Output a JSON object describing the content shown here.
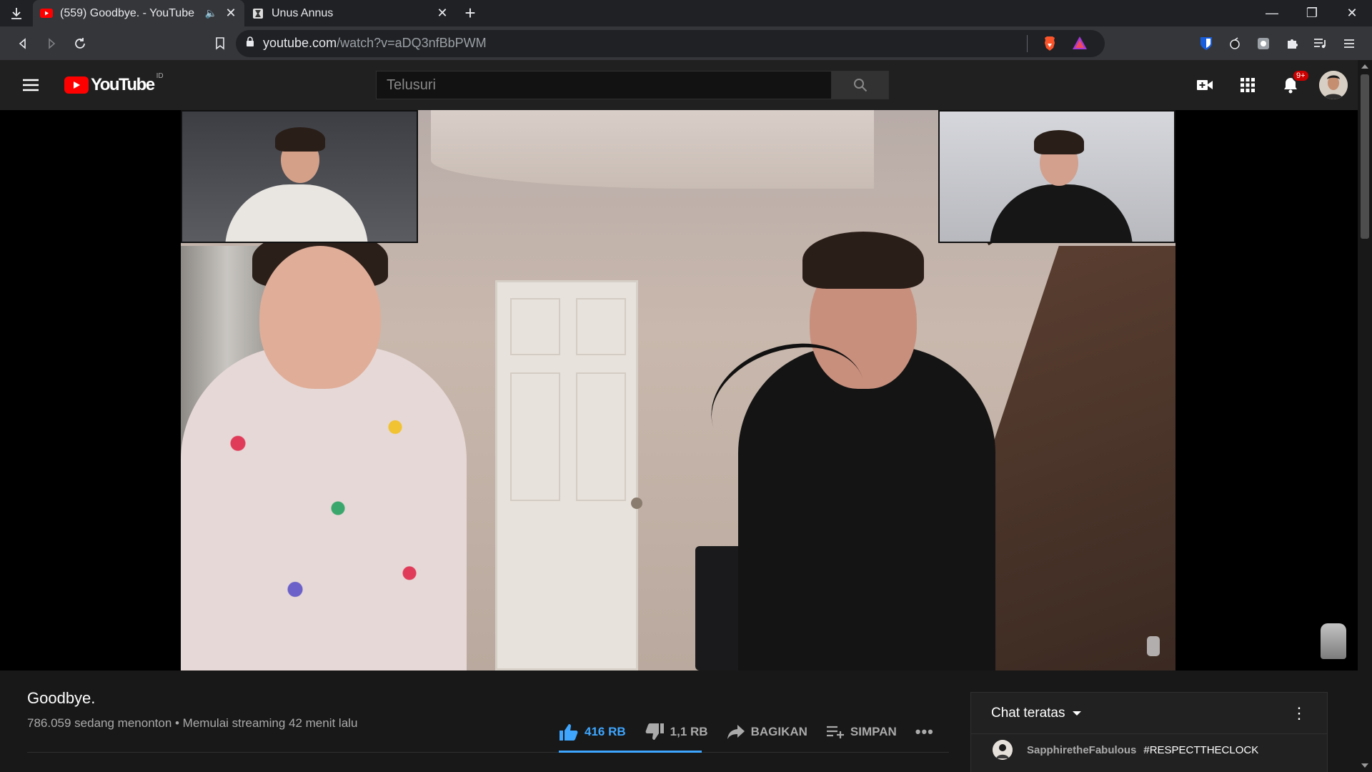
{
  "browser": {
    "tabs": [
      {
        "title": "(559) Goodbye. - YouTube",
        "favicon": "youtube-favicon",
        "audio": "speaker-icon",
        "active": true
      },
      {
        "title": "Unus Annus",
        "favicon": "unus-annus-favicon",
        "active": false
      }
    ],
    "url_host": "youtube.com",
    "url_path": "/watch?v=aDQ3nfBbPWM"
  },
  "youtube": {
    "logo_text": "YouTube",
    "country_code": "ID",
    "search_placeholder": "Telusuri",
    "notification_count": "9+"
  },
  "video": {
    "title": "Goodbye.",
    "meta": "786.059 sedang menonton • Memulai streaming 42 menit lalu",
    "like_label": "416 RB",
    "dislike_label": "1,1 RB",
    "share_label": "BAGIKAN",
    "save_label": "SIMPAN"
  },
  "chat": {
    "mode_label": "Chat teratas",
    "messages": [
      {
        "author": "SapphiretheFabulous",
        "text": "#RESPECTTHECLOCK"
      }
    ]
  },
  "colors": {
    "accent_blue": "#3ea6ff",
    "youtube_red": "#ff0000",
    "background": "#181818"
  }
}
